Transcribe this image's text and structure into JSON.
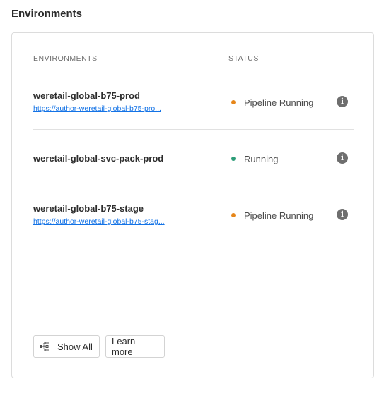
{
  "section": {
    "title": "Environments"
  },
  "table": {
    "headers": {
      "environments": "ENVIRONMENTS",
      "status": "STATUS"
    },
    "rows": [
      {
        "name": "weretail-global-b75-prod",
        "url": "https://author-weretail-global-b75-pro...",
        "status": "Pipeline Running",
        "status_color": "#e68619"
      },
      {
        "name": "weretail-global-svc-pack-prod",
        "url": "",
        "status": "Running",
        "status_color": "#2d9d78"
      },
      {
        "name": "weretail-global-b75-stage",
        "url": "https://author-weretail-global-b75-stag...",
        "status": "Pipeline Running",
        "status_color": "#e68619"
      }
    ]
  },
  "actions": {
    "show_all": "Show All",
    "learn_more": "Learn more"
  },
  "icons": {
    "info": "info-icon",
    "show_all": "hierarchy-icon"
  }
}
